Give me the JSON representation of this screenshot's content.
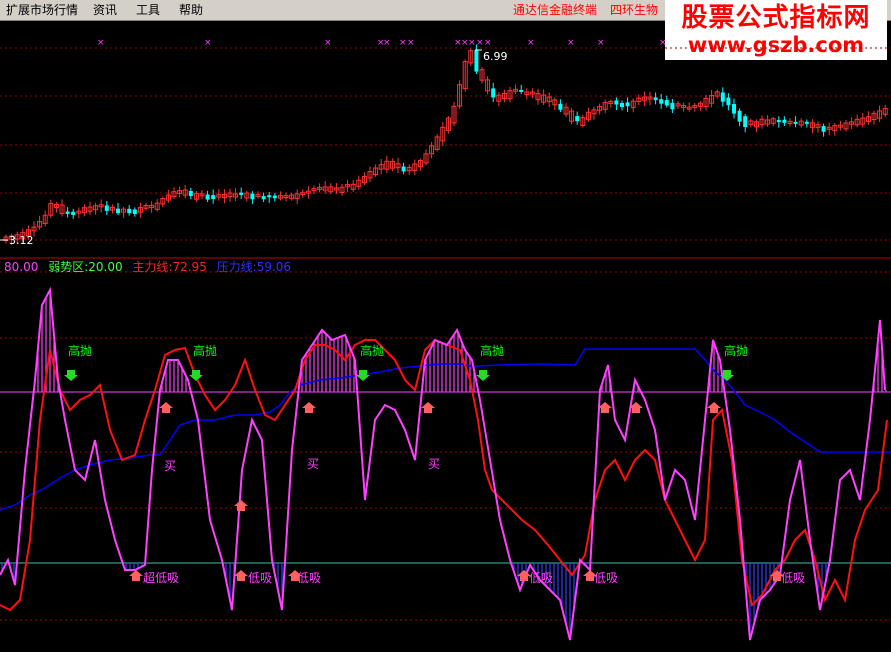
{
  "menu": {
    "items": [
      "扩展市场行情",
      "资讯",
      "工具",
      "帮助"
    ],
    "right_links": [
      "通达信金融终端",
      "四环生物"
    ]
  },
  "watermark": {
    "line1": "股票公式指标网",
    "line2": "www.gszb.com"
  },
  "price_panel": {
    "high_label": "6.99",
    "low_label": "3.12"
  },
  "indicator_legend": {
    "strong_zone": "80.00",
    "weak_zone_label": "弱势区:",
    "weak_zone_value": "20.00",
    "main_line_label": "主力线:",
    "main_line_value": "72.95",
    "pressure_line_label": "压力线:",
    "pressure_line_value": "59.06"
  },
  "signals": {
    "sell_text": "高抛",
    "buy_text": "买",
    "low_buy_text": "低吸",
    "low_buy_text_alt": "超低吸"
  },
  "colors": {
    "up": "#ff3232",
    "down": "#00ffff",
    "grid": "#a00000",
    "main_line": "#ff0000",
    "magenta_line": "#ff40ff",
    "pressure_line": "#0000ff",
    "sell_label": "#00ff00",
    "buy_label": "#ff40ff"
  }
}
